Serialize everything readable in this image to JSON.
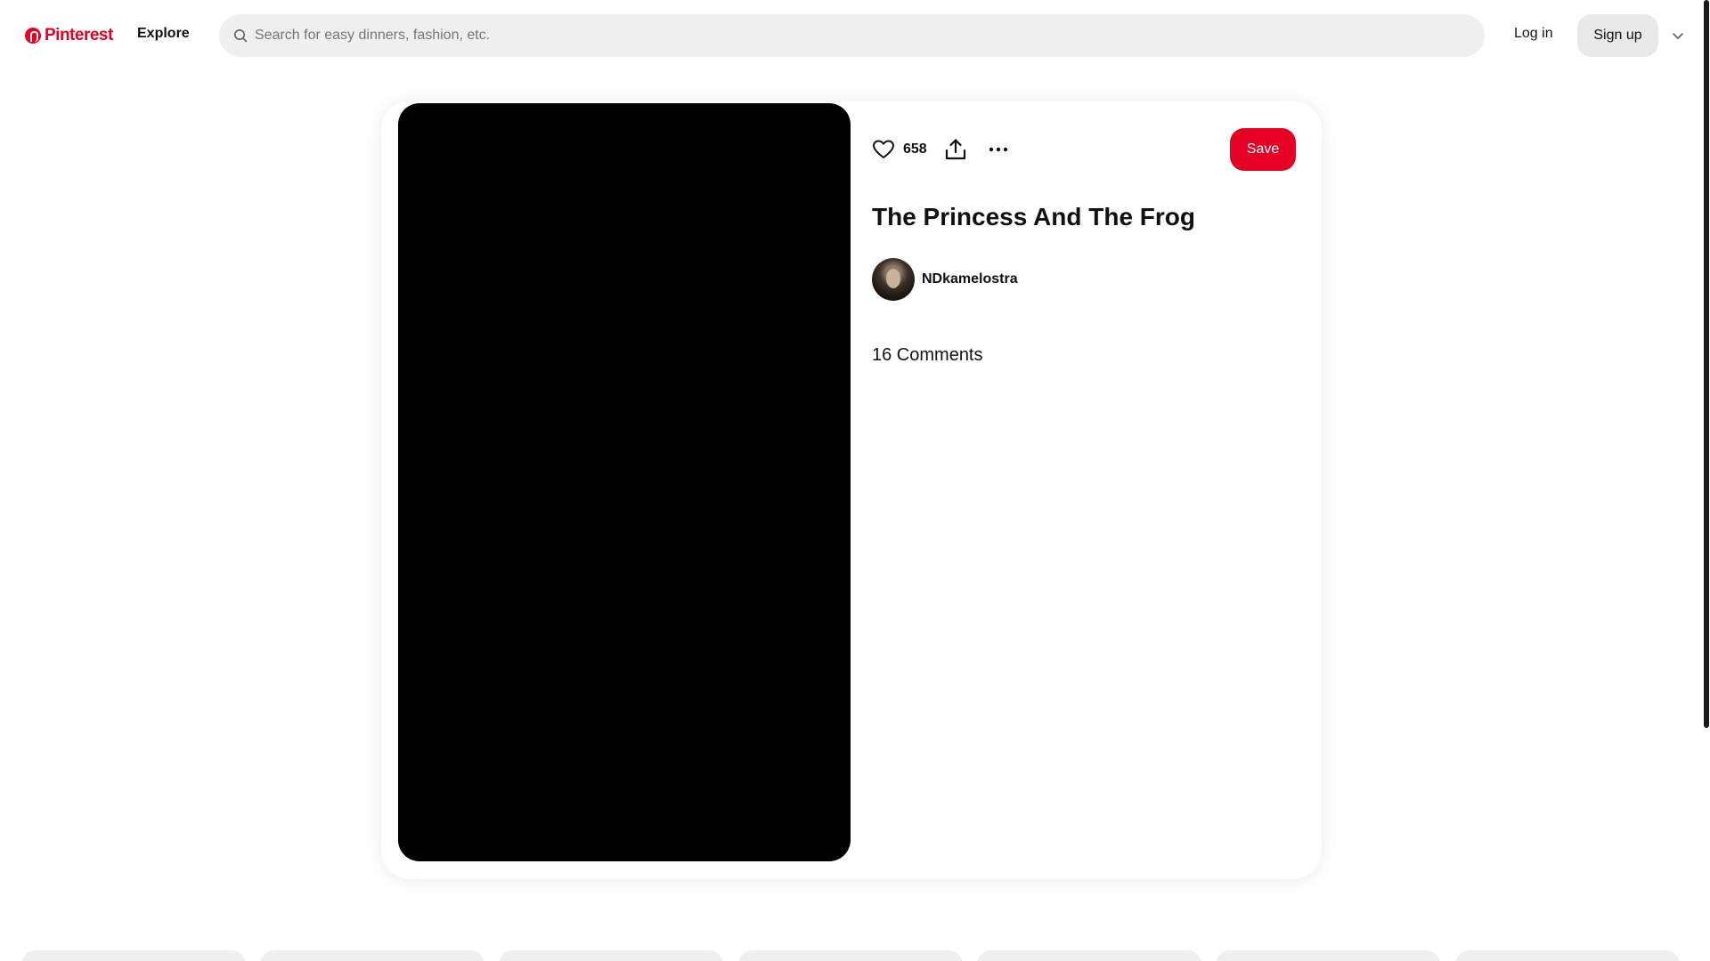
{
  "header": {
    "logo_text": "Pinterest",
    "explore_label": "Explore",
    "search_placeholder": "Search for easy dinners, fashion, etc.",
    "login_label": "Log in",
    "signup_label": "Sign up"
  },
  "pin": {
    "like_count": "658",
    "save_label": "Save",
    "title": "The Princess And The Frog",
    "creator_name": "NDkamelostra",
    "comments_label": "16 Comments"
  },
  "colors": {
    "brand": "#e60023",
    "media_background": "#000000",
    "search_background": "#efefef",
    "signup_background": "#e9e9e9"
  },
  "icons": [
    "pinterest-logo-icon",
    "search-icon",
    "chevron-down-icon",
    "heart-icon",
    "share-icon",
    "more-icon"
  ]
}
